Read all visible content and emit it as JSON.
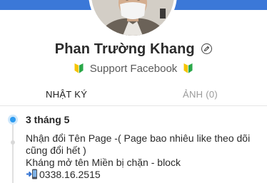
{
  "profile": {
    "name": "Phan Trường Khang",
    "subtitle": "Support Facebook",
    "badge_icon": "beginner-leaf-icon",
    "edit_icon": "pencil-icon"
  },
  "tabs": [
    {
      "label": "NHẬT KÝ",
      "active": true
    },
    {
      "label": "ẢNH (0)",
      "active": false
    }
  ],
  "timeline": {
    "date": "3 tháng 5",
    "post_lines": [
      "Nhận đổi Tên Page -( Page bao nhiêu like theo dõi",
      "cũng đổi hết )",
      "Kháng mở tên Miền bị chặn - block"
    ],
    "phone": "0338.16.2515",
    "phone_icon": "phone-incoming-icon"
  },
  "colors": {
    "accent": "#2e9bf0",
    "cover": "#3b78d8"
  }
}
